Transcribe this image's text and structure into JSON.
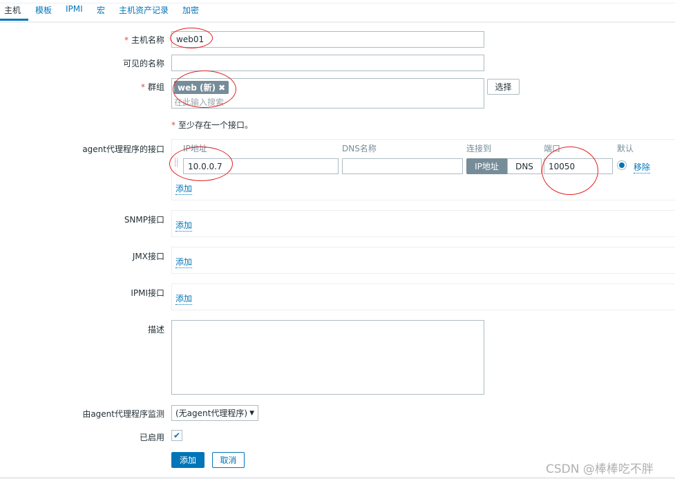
{
  "tabs": [
    "主机",
    "模板",
    "IPMI",
    "宏",
    "主机资产记录",
    "加密"
  ],
  "form": {
    "host_name_label": "主机名称",
    "host_name_value": "web01",
    "visible_name_label": "可见的名称",
    "visible_name_value": "",
    "groups_label": "群组",
    "group_tag": "web (新)",
    "group_placeholder": "在此输入搜索",
    "select_button": "选择",
    "required_mark": "*",
    "interface_note": "至少存在一个接口。",
    "agent_label": "agent代理程序的接口",
    "col_ip": "IP地址",
    "col_dns": "DNS名称",
    "col_connect": "连接到",
    "col_port": "端口",
    "col_default": "默认",
    "ip_value": "10.0.0.7",
    "dns_value": "",
    "connect_ip": "IP地址",
    "connect_dns": "DNS",
    "port_value": "10050",
    "remove": "移除",
    "add": "添加",
    "snmp_label": "SNMP接口",
    "jmx_label": "JMX接口",
    "ipmi_label": "IPMI接口",
    "description_label": "描述",
    "description_value": "",
    "proxy_label": "由agent代理程序监测",
    "proxy_value": "(无agent代理程序)",
    "enabled_label": "已启用",
    "enabled": true,
    "submit": "添加",
    "cancel": "取消"
  },
  "watermark": "CSDN @棒棒吃不胖"
}
